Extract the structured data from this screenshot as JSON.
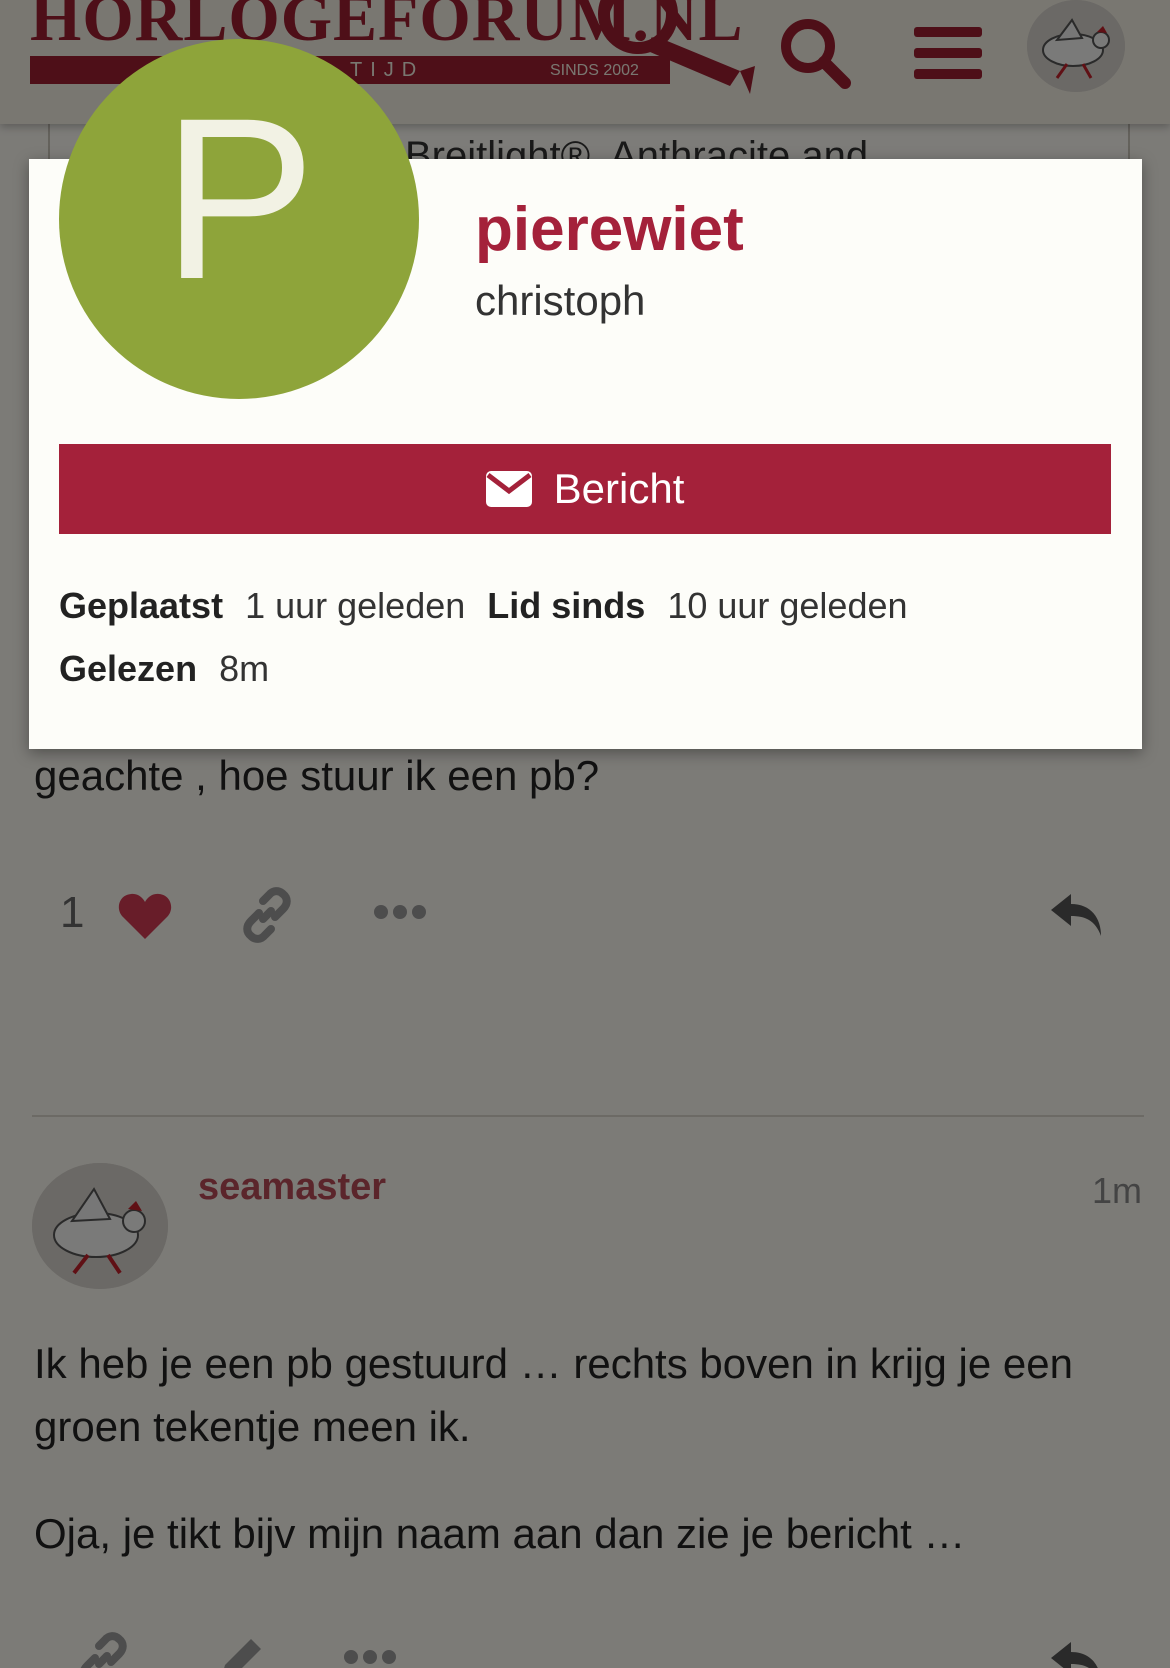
{
  "header": {
    "logo_title": "HORLOGEFORUM.NL",
    "logo_tagline": "TIJD",
    "logo_since": "SINDS 2002",
    "search_icon": "search-icon",
    "menu_icon": "hamburger-menu-icon",
    "avatar_icon": "chicken-avatar-icon"
  },
  "background": {
    "topic_card_text": "Breitlight®, Anthracite and",
    "post1_body": "geachte , hoe stuur ik een pb?",
    "post1_like_count": "1",
    "post2": {
      "username": "seamaster",
      "time": "1m",
      "paragraph1": "Ik heb je een pb gestuurd … rechts boven in krijg je een groen tekentje meen ik.",
      "paragraph2": "Oja, je tikt bijv mijn naam aan dan zie je bericht …"
    }
  },
  "user_card": {
    "avatar_letter": "P",
    "avatar_color": "#8ea43a",
    "username": "pierewiet",
    "name": "christoph",
    "message_button_label": "Bericht",
    "stats": {
      "posted_label": "Geplaatst",
      "posted_value": "1 uur geleden",
      "member_since_label": "Lid sinds",
      "member_since_value": "10 uur geleden",
      "read_label": "Gelezen",
      "read_value": "8m"
    }
  },
  "colors": {
    "brand": "#a4213a",
    "like_heart": "#d03a52"
  }
}
